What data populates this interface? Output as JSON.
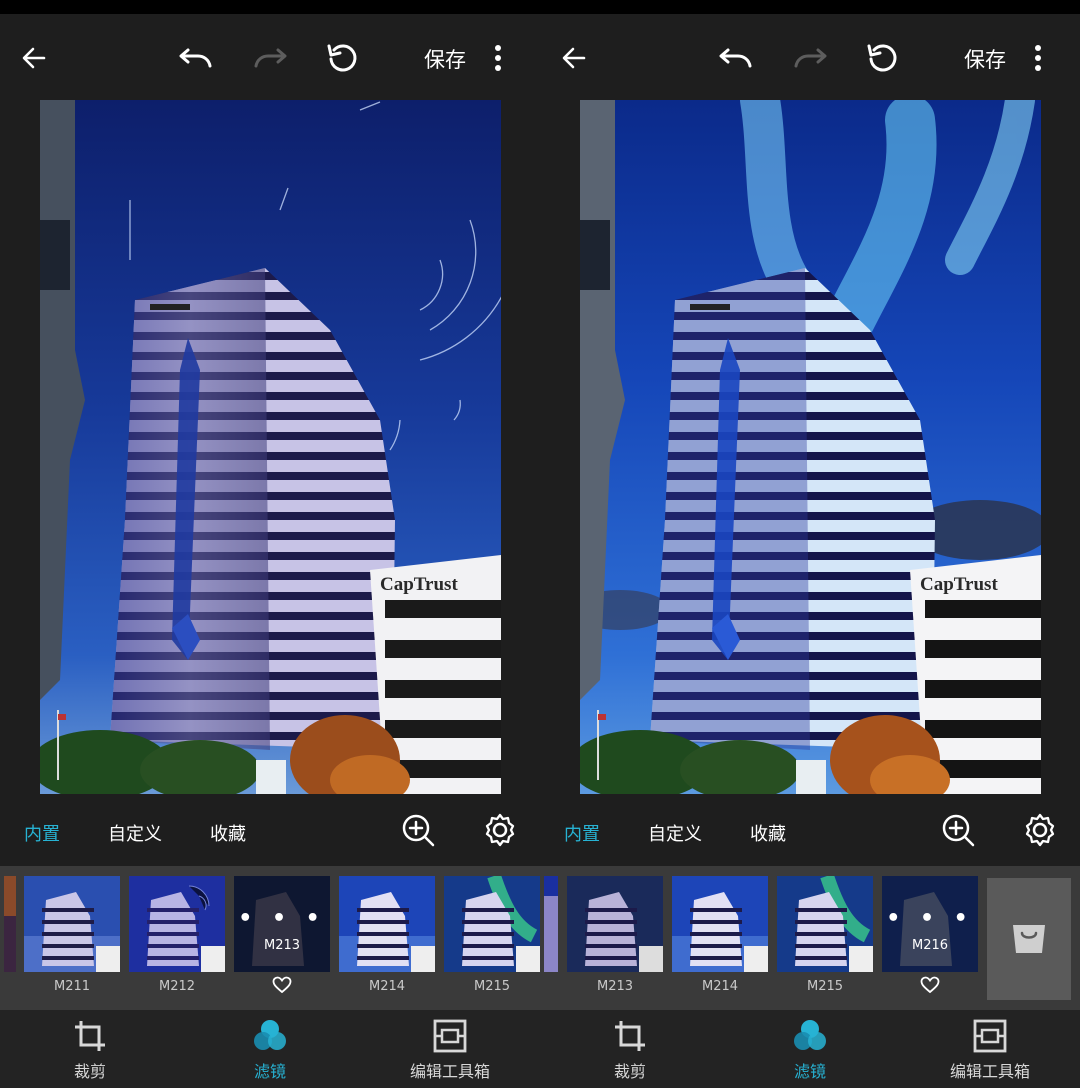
{
  "colors": {
    "accent": "#27b3d4",
    "panel_bg": "#1e1e1e",
    "strip_bg": "#3a3a3a",
    "store_bg": "#5a5a5a"
  },
  "panels": [
    {
      "topbar": {
        "back_icon": "arrow-left-icon",
        "undo_icon": "undo-icon",
        "redo_icon": "redo-icon",
        "reset_icon": "rotate-icon",
        "save_label": "保存",
        "more_icon": "more-vertical-icon"
      },
      "photo": {
        "building_sign": "CapTrust",
        "sky_effect": "star-trails"
      },
      "tabs": {
        "builtin": "内置",
        "custom": "自定义",
        "favorites": "收藏",
        "zoom_icon": "zoom-in-icon",
        "settings_icon": "gear-icon"
      },
      "filters": [
        {
          "name": "M211",
          "selected": false
        },
        {
          "name": "M212",
          "selected": false
        },
        {
          "name": "M213",
          "selected": true
        },
        {
          "name": "M214",
          "selected": false
        },
        {
          "name": "M215",
          "selected": false
        }
      ],
      "nav": {
        "crop": "裁剪",
        "filter": "滤镜",
        "toolbox": "编辑工具箱"
      }
    },
    {
      "topbar": {
        "back_icon": "arrow-left-icon",
        "undo_icon": "undo-icon",
        "redo_icon": "redo-icon",
        "reset_icon": "rotate-icon",
        "save_label": "保存",
        "more_icon": "more-vertical-icon"
      },
      "photo": {
        "building_sign": "CapTrust",
        "sky_effect": "aurora"
      },
      "tabs": {
        "builtin": "内置",
        "custom": "自定义",
        "favorites": "收藏",
        "zoom_icon": "zoom-in-icon",
        "settings_icon": "gear-icon"
      },
      "filters": [
        {
          "name": "M213",
          "selected": false
        },
        {
          "name": "M214",
          "selected": false
        },
        {
          "name": "M215",
          "selected": false
        },
        {
          "name": "M216",
          "selected": true
        }
      ],
      "store_icon": "shopping-bag-icon",
      "nav": {
        "crop": "裁剪",
        "filter": "滤镜",
        "toolbox": "编辑工具箱"
      }
    }
  ]
}
